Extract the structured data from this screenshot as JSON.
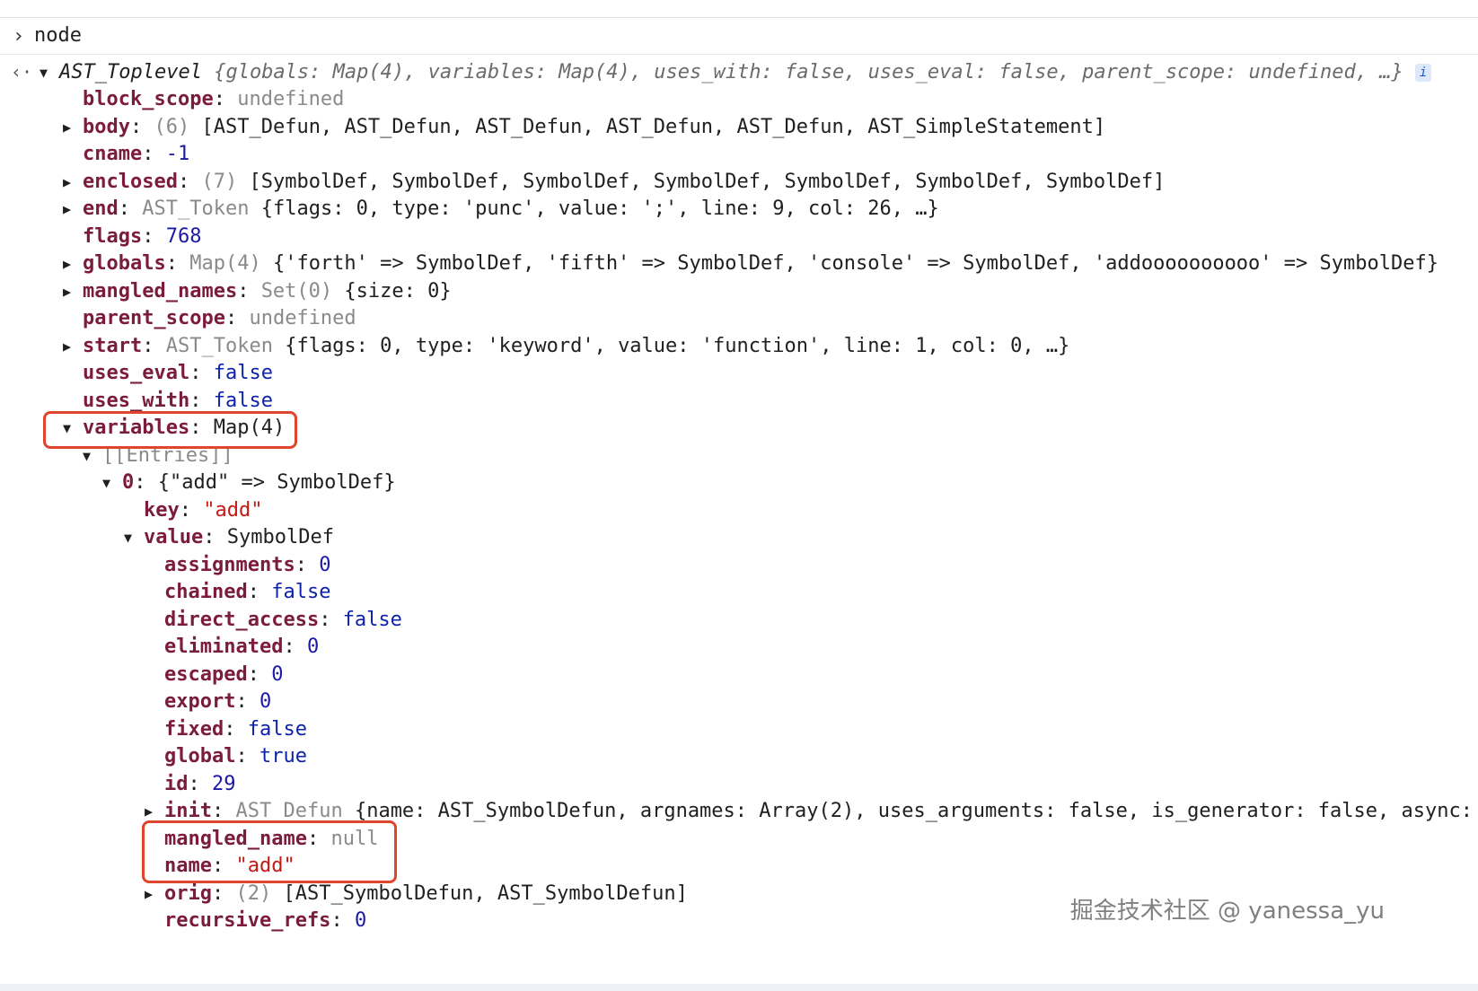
{
  "console": {
    "prompt_symbol": ">",
    "command": "node",
    "back_symbol": "<·",
    "header": {
      "name": "AST_Toplevel",
      "preview": "{globals: Map(4), variables: Map(4), uses_with: false, uses_eval: false, parent_scope: undefined, …}",
      "info_icon": "i"
    },
    "props": {
      "block_scope": {
        "key": "block_scope",
        "val": "undefined"
      },
      "body": {
        "key": "body",
        "count": "(6)",
        "val": "[AST_Defun, AST_Defun, AST_Defun, AST_Defun, AST_Defun, AST_SimpleStatement]"
      },
      "cname": {
        "key": "cname",
        "val": "-1"
      },
      "enclosed": {
        "key": "enclosed",
        "count": "(7)",
        "val": "[SymbolDef, SymbolDef, SymbolDef, SymbolDef, SymbolDef, SymbolDef, SymbolDef]"
      },
      "end": {
        "key": "end",
        "cls": "AST_Token",
        "val": "{flags: 0, type: 'punc', value: ';', line: 9, col: 26, …}"
      },
      "flags": {
        "key": "flags",
        "val": "768"
      },
      "globals": {
        "key": "globals",
        "cls": "Map(4)",
        "val": "{'forth' => SymbolDef, 'fifth' => SymbolDef, 'console' => SymbolDef, 'addoooooooooo' => SymbolDef}"
      },
      "mangled_names": {
        "key": "mangled_names",
        "cls": "Set(0)",
        "val": "{size: 0}"
      },
      "parent_scope": {
        "key": "parent_scope",
        "val": "undefined"
      },
      "start": {
        "key": "start",
        "cls": "AST_Token",
        "val": "{flags: 0, type: 'keyword', value: 'function', line: 1, col: 0, …}"
      },
      "uses_eval": {
        "key": "uses_eval",
        "val": "false"
      },
      "uses_with": {
        "key": "uses_with",
        "val": "false"
      },
      "variables": {
        "key": "variables",
        "val": "Map(4)"
      }
    },
    "entries_label": "[[Entries]]",
    "entry0": {
      "index": "0",
      "val": "{\"add\" => SymbolDef}"
    },
    "key_prop": {
      "key": "key",
      "val": "\"add\""
    },
    "value_prop": {
      "key": "value",
      "val": "SymbolDef"
    },
    "symbol": {
      "assignments": {
        "key": "assignments",
        "val": "0"
      },
      "chained": {
        "key": "chained",
        "val": "false"
      },
      "direct_access": {
        "key": "direct_access",
        "val": "false"
      },
      "eliminated": {
        "key": "eliminated",
        "val": "0"
      },
      "escaped": {
        "key": "escaped",
        "val": "0"
      },
      "export": {
        "key": "export",
        "val": "0"
      },
      "fixed": {
        "key": "fixed",
        "val": "false"
      },
      "global": {
        "key": "global",
        "val": "true"
      },
      "id": {
        "key": "id",
        "val": "29"
      },
      "init": {
        "key": "init",
        "cls": "AST_Defun",
        "val": "{name: AST_SymbolDefun, argnames: Array(2), uses_arguments: false, is_generator: false, async:"
      },
      "mangled_name": {
        "key": "mangled_name",
        "val": "null"
      },
      "name": {
        "key": "name",
        "val": "\"add\""
      },
      "orig": {
        "key": "orig",
        "count": "(2)",
        "val": "[AST_SymbolDefun, AST_SymbolDefun]"
      },
      "recursive_refs": {
        "key": "recursive_refs",
        "val": "0"
      }
    }
  },
  "watermark": "掘金技术社区 @ yanessa_yu",
  "colors": {
    "key": "#7a1c3a",
    "number": "#1a1aa6",
    "string": "#c41a16",
    "highlight": "#e0452e"
  }
}
